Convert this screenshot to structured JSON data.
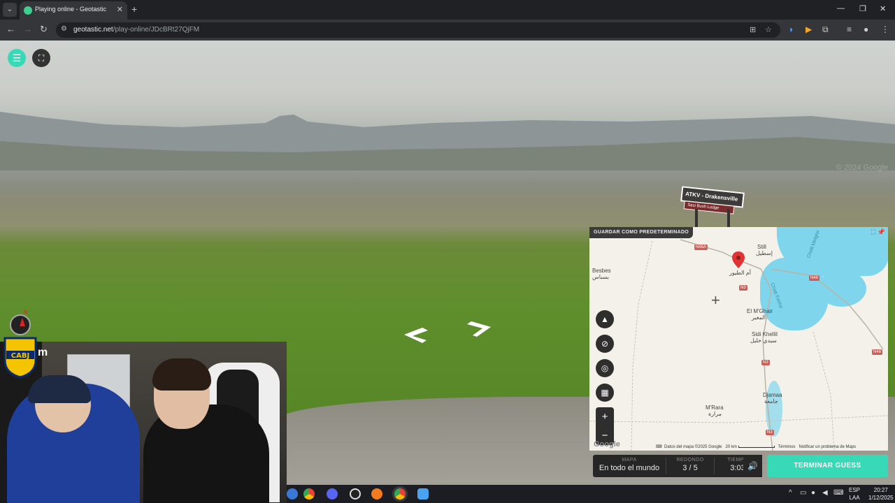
{
  "browser": {
    "tab_title": "Playing online - Geotastic",
    "url_host": "geotastic.net",
    "url_path": "/play-online/JDcBRt27QjFM"
  },
  "streetview": {
    "watermark": "© 2024 Google",
    "sign_main": "ATKV - Drakensville",
    "sign_sub": "Sasi Bush Lodge"
  },
  "overlay": {
    "partial_name": "m"
  },
  "map": {
    "save_default_label": "GUARDAR COMO PREDETERMINADO",
    "labels": {
      "besbes": "Besbes",
      "besbes_ar": "بسباس",
      "still": "Still",
      "still_ar": "إسطيل",
      "oum_tiour_ar": "أم الطيور",
      "el_mghair": "El M'Ghair",
      "el_mghair_ar": "المغير",
      "sidi_khellil": "Sidi Khellil",
      "sidi_khellil_ar": "سيدي خليل",
      "djamaa": "Djamaa",
      "djamaa_ar": "جامعة",
      "mrara": "M'Rara",
      "mrara_ar": "مرارة",
      "chott_merouane": "Chott Melghir",
      "chott_felrhir": "Chott Felrhir"
    },
    "roads": {
      "n46a": "N46A",
      "n48a": "N48",
      "n3a": "N3",
      "n48b": "N48",
      "n3b": "N3",
      "n3c": "N3"
    },
    "attribution": {
      "data": "Datos del mapa ©2025 Google",
      "scale": "20 km",
      "terms": "Términos",
      "report": "Notificar un problema de Maps"
    },
    "google": "Google"
  },
  "game": {
    "map_key": "MAPA",
    "map_val": "En todo el mundo",
    "round_key": "REDONDO",
    "round_val": "3 / 5",
    "time_key": "TIEMPO",
    "time_val": "3:03",
    "guess_label": "TERMINAR GUESS"
  },
  "taskbar": {
    "lang_1": "ESP",
    "lang_2": "LAA",
    "time": "20:27",
    "date": "1/12/2025"
  },
  "colors": {
    "accent": "#38d9b7",
    "map_water": "#7fd6ec",
    "pin": "#e03434"
  }
}
